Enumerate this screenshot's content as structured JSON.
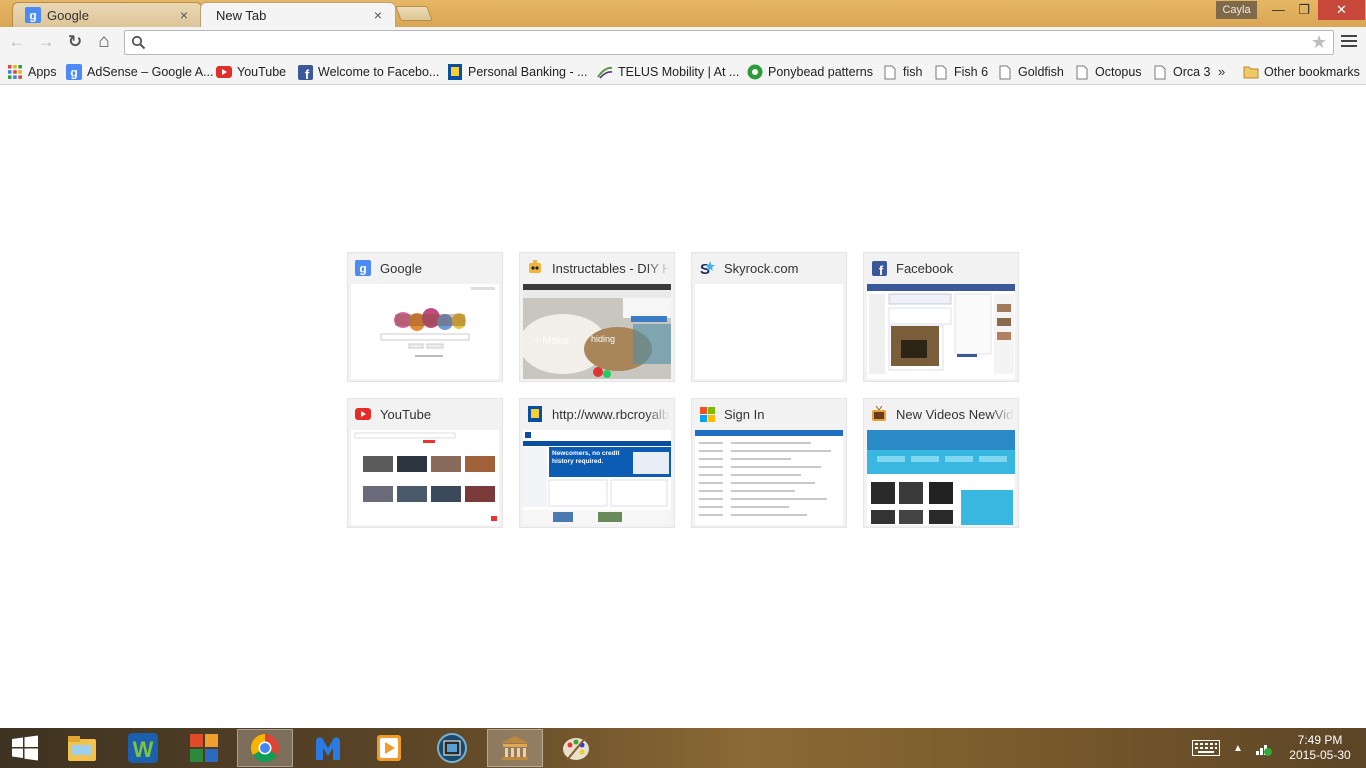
{
  "window": {
    "profile_name": "Cayla",
    "minimize_glyph": "—",
    "maximize_glyph": "❐",
    "close_glyph": "✕"
  },
  "tabs": [
    {
      "title": "Google",
      "icon": "google-icon",
      "active": false,
      "close": "×"
    },
    {
      "title": "New Tab",
      "icon": "none",
      "active": true,
      "close": "×"
    }
  ],
  "toolbar": {
    "omnibox_value": "",
    "omnibox_placeholder": "",
    "back_glyph": "←",
    "forward_glyph": "→",
    "reload_glyph": "↻",
    "home_glyph": "⌂",
    "star_glyph": "★"
  },
  "bookmarks": {
    "items": [
      {
        "label": "Apps",
        "icon": "apps-grid-icon"
      },
      {
        "label": "AdSense – Google A...",
        "icon": "google-icon"
      },
      {
        "label": "YouTube",
        "icon": "youtube-icon"
      },
      {
        "label": "Welcome to Facebo...",
        "icon": "facebook-icon"
      },
      {
        "label": "Personal Banking - ...",
        "icon": "rbc-icon"
      },
      {
        "label": "TELUS Mobility | At ...",
        "icon": "telus-icon"
      },
      {
        "label": "Ponybead patterns",
        "icon": "ponybead-icon"
      },
      {
        "label": "fish",
        "icon": "page-icon"
      },
      {
        "label": "Fish 6",
        "icon": "page-icon"
      },
      {
        "label": "Goldfish",
        "icon": "page-icon"
      },
      {
        "label": "Octopus",
        "icon": "page-icon"
      },
      {
        "label": "Orca 3",
        "icon": "page-icon"
      }
    ],
    "overflow": "»",
    "other_bookmarks": "Other bookmarks"
  },
  "most_visited": [
    {
      "title": "Google",
      "icon": "google-icon"
    },
    {
      "title": "Instructables - DIY How To",
      "icon": "instructables-icon"
    },
    {
      "title": "Skyrock.com",
      "icon": "skyrock-icon"
    },
    {
      "title": "Facebook",
      "icon": "facebook-icon"
    },
    {
      "title": "YouTube",
      "icon": "youtube-icon"
    },
    {
      "title": "http://www.rbcroyalbank.com",
      "icon": "rbc-icon"
    },
    {
      "title": "Sign In",
      "icon": "microsoft-icon"
    },
    {
      "title": "New Videos NewVideos",
      "icon": "tv-icon"
    }
  ],
  "thumbnails": {
    "instructables_caption": "hiding",
    "rbc_banner": "Newcomers, no credit history required."
  },
  "taskbar": {
    "items": [
      "windows-start-icon",
      "file-explorer-icon",
      "wordperfect-icon",
      "office-icon",
      "chrome-icon",
      "malwarebytes-icon",
      "media-player-icon",
      "video-editor-icon",
      "bank-building-icon",
      "paint-palette-icon"
    ],
    "active": "chrome-icon",
    "time": "7:49 PM",
    "date": "2015-05-30"
  },
  "colors": {
    "titlebar": "#d9a654",
    "close_button": "#c7483a",
    "toolbar_bg": "#f4f4f4",
    "google_blue": "#4285f4",
    "youtube_red": "#e52d27",
    "facebook_blue": "#3b5998"
  }
}
